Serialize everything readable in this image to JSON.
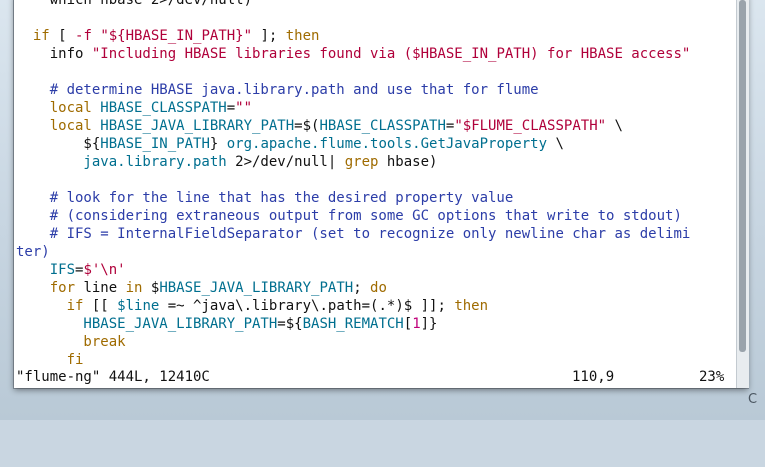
{
  "editor": {
    "lines": [
      [
        {
          "c": "tx",
          "t": "    which hbase 2>/dev/null)"
        }
      ],
      [
        {
          "c": "tx",
          "t": ""
        }
      ],
      [
        {
          "c": "kw",
          "t": "  if"
        },
        {
          "c": "tx",
          "t": " [ "
        },
        {
          "c": "str",
          "t": "-f"
        },
        {
          "c": "tx",
          "t": " "
        },
        {
          "c": "str",
          "t": "\"${HBASE_IN_PATH}\""
        },
        {
          "c": "tx",
          "t": " ]; "
        },
        {
          "c": "kw",
          "t": "then"
        }
      ],
      [
        {
          "c": "tx",
          "t": "    info "
        },
        {
          "c": "str",
          "t": "\"Including HBASE libraries found via ($HBASE_IN_PATH) for HBASE access\""
        }
      ],
      [
        {
          "c": "tx",
          "t": ""
        }
      ],
      [
        {
          "c": "cm",
          "t": "    # determine HBASE java.library.path and use that for flume"
        }
      ],
      [
        {
          "c": "kw",
          "t": "    local"
        },
        {
          "c": "tx",
          "t": " "
        },
        {
          "c": "var",
          "t": "HBASE_CLASSPATH"
        },
        {
          "c": "tx",
          "t": "="
        },
        {
          "c": "str",
          "t": "\"\""
        }
      ],
      [
        {
          "c": "kw",
          "t": "    local"
        },
        {
          "c": "tx",
          "t": " "
        },
        {
          "c": "var",
          "t": "HBASE_JAVA_LIBRARY_PATH"
        },
        {
          "c": "tx",
          "t": "=$("
        },
        {
          "c": "var",
          "t": "HBASE_CLASSPATH"
        },
        {
          "c": "tx",
          "t": "="
        },
        {
          "c": "str",
          "t": "\"$FLUME_CLASSPATH\""
        },
        {
          "c": "tx",
          "t": " \\"
        }
      ],
      [
        {
          "c": "tx",
          "t": "        ${"
        },
        {
          "c": "var",
          "t": "HBASE_IN_PATH"
        },
        {
          "c": "tx",
          "t": "} "
        },
        {
          "c": "var",
          "t": "org.apache.flume.tools.GetJavaProperty"
        },
        {
          "c": "tx",
          "t": " \\"
        }
      ],
      [
        {
          "c": "var",
          "t": "        java.library.path"
        },
        {
          "c": "tx",
          "t": " 2>/dev/null| "
        },
        {
          "c": "kw",
          "t": "grep"
        },
        {
          "c": "tx",
          "t": " hbase)"
        }
      ],
      [
        {
          "c": "tx",
          "t": ""
        }
      ],
      [
        {
          "c": "cm",
          "t": "    # look for the line that has the desired property value"
        }
      ],
      [
        {
          "c": "cm",
          "t": "    # (considering extraneous output from some GC options that write to stdout)"
        }
      ],
      [
        {
          "c": "cm",
          "t": "    # IFS = InternalFieldSeparator (set to recognize only newline char as delimi"
        }
      ],
      [
        {
          "c": "cm",
          "t": "ter)"
        }
      ],
      [
        {
          "c": "var",
          "t": "    IFS"
        },
        {
          "c": "tx",
          "t": "="
        },
        {
          "c": "str",
          "t": "$'\\n'"
        }
      ],
      [
        {
          "c": "kw",
          "t": "    for"
        },
        {
          "c": "tx",
          "t": " line "
        },
        {
          "c": "kw",
          "t": "in"
        },
        {
          "c": "tx",
          "t": " $"
        },
        {
          "c": "var",
          "t": "HBASE_JAVA_LIBRARY_PATH"
        },
        {
          "c": "tx",
          "t": "; "
        },
        {
          "c": "kw",
          "t": "do"
        }
      ],
      [
        {
          "c": "kw",
          "t": "      if"
        },
        {
          "c": "tx",
          "t": " [[ "
        },
        {
          "c": "var",
          "t": "$line"
        },
        {
          "c": "tx",
          "t": " =~ ^java\\.library\\.path=(.*)$ ]]; "
        },
        {
          "c": "kw",
          "t": "then"
        }
      ],
      [
        {
          "c": "var",
          "t": "        HBASE_JAVA_LIBRARY_PATH"
        },
        {
          "c": "tx",
          "t": "=${"
        },
        {
          "c": "var",
          "t": "BASH_REMATCH"
        },
        {
          "c": "tx",
          "t": "["
        },
        {
          "c": "mag",
          "t": "1"
        },
        {
          "c": "tx",
          "t": "]}"
        }
      ],
      [
        {
          "c": "kw",
          "t": "        break"
        }
      ],
      [
        {
          "c": "kw",
          "t": "      fi"
        }
      ]
    ]
  },
  "status": {
    "file": "\"flume-ng\" 444L, 12410C",
    "position": "110,9",
    "percent": "23%"
  },
  "corner_glyph": "C"
}
